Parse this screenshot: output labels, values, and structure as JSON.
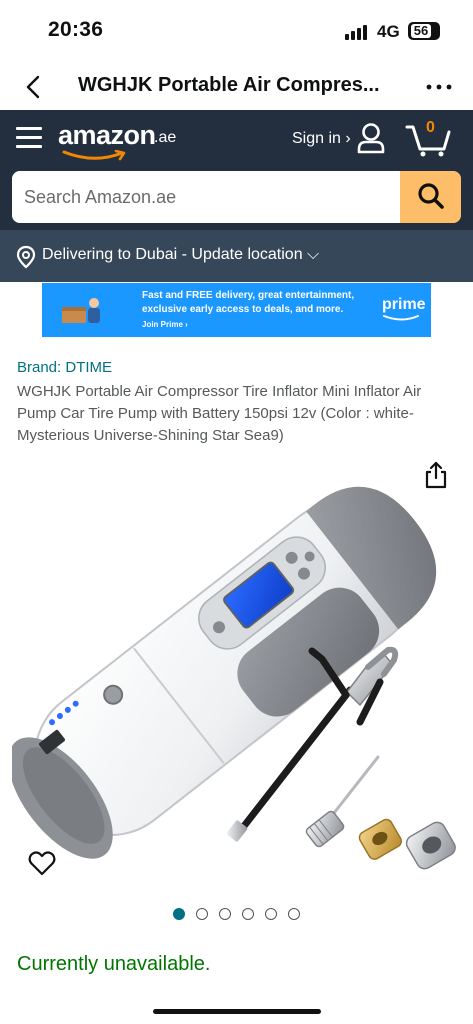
{
  "status_bar": {
    "time": "20:36",
    "network": "4G",
    "battery": "56"
  },
  "title_bar": {
    "title": "WGHJK Portable Air Compres..."
  },
  "header": {
    "logo_text": "amazon",
    "logo_tld": ".ae",
    "signin_label": "Sign in ›",
    "cart_count": "0",
    "search_placeholder": "Search Amazon.ae",
    "delivery_text": "Delivering to Dubai - Update location ⌵"
  },
  "banner": {
    "line1": "Fast and FREE delivery, great entertainment,",
    "line2": "exclusive early access to deals, and more.",
    "join": "Join Prime ›",
    "prime": "prime"
  },
  "product": {
    "brand": "Brand: DTIME",
    "title": "WGHJK Portable Air Compressor Tire Inflator Mini Inflator Air Pump Car Tire Pump with Battery 150psi 12v (Color : white-Mysterious Universe-Shining Star Sea9)",
    "availability": "Currently unavailable.",
    "image_count": 6,
    "active_image": 1
  },
  "colors": {
    "header_bg": "#232F3E",
    "delivery_bg": "#37475A",
    "search_button": "#FEBD69",
    "link": "#007185",
    "availability": "#007600",
    "cart_count": "#F08804",
    "prime_banner": "#1A98FF"
  },
  "icons": {
    "back": "chevron-left-icon",
    "more": "ellipsis-icon",
    "menu": "hamburger-icon",
    "user": "user-icon",
    "cart": "cart-icon",
    "search": "search-icon",
    "location": "location-pin-icon",
    "share": "share-icon",
    "wishlist": "heart-icon"
  }
}
